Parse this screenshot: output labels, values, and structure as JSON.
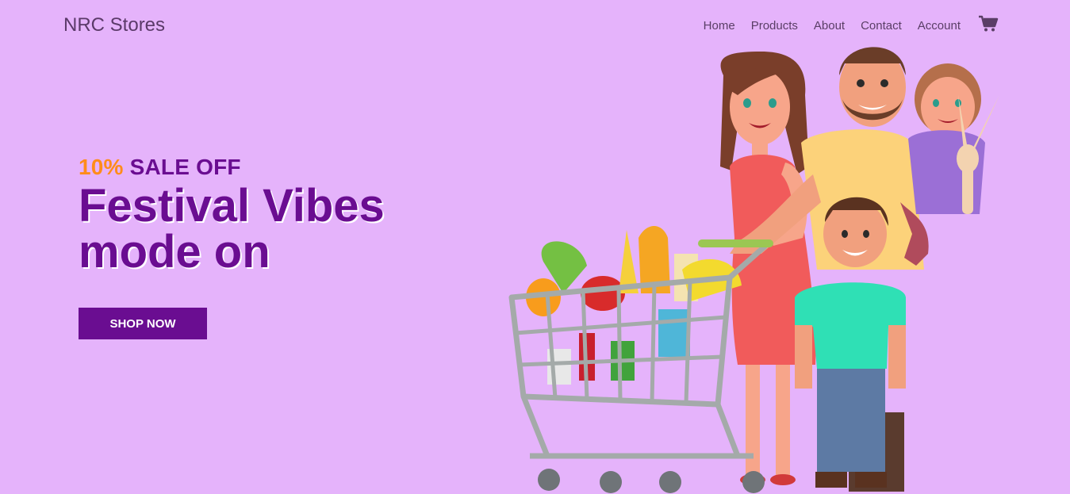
{
  "brand": "NRC Stores",
  "nav": {
    "home": "Home",
    "products": "Products",
    "about": "About",
    "contact": "Contact",
    "account": "Account",
    "cart_icon": "cart-icon"
  },
  "hero": {
    "discount": "10%",
    "sale_text": "SALE OFF",
    "headline_line1": "Festival Vibes",
    "headline_line2": "mode on",
    "cta": "SHOP NOW"
  },
  "illustration": {
    "description_icon": "family-shopping-illustration"
  },
  "colors": {
    "background": "#e5b3fb",
    "accent": "#6a0d91",
    "highlight": "#ff8c1a"
  }
}
